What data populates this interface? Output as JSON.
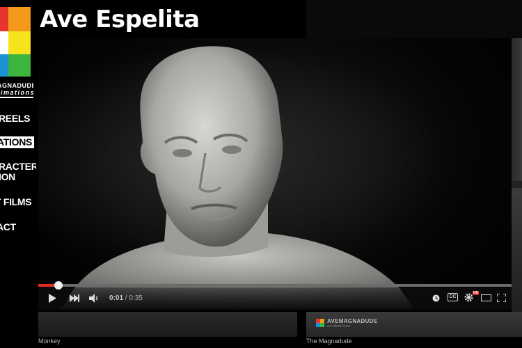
{
  "site": {
    "title": "Ave Espelita",
    "logo_line1": "MAGNADUDE",
    "logo_line2": "Animations",
    "logo_colors": [
      "#e8352b",
      "#f39a1b",
      "#ffffff",
      "#f6e31c",
      "#1a94d2",
      "#3db43d",
      "#f7d50f"
    ]
  },
  "nav": {
    "items": [
      {
        "label": "REELS",
        "active": false
      },
      {
        "label": "ATIONS",
        "active": true
      },
      {
        "label": "RACTER",
        "active": false
      },
      {
        "label": "ION",
        "active": false
      },
      {
        "label": "T FILMS",
        "active": false
      },
      {
        "label": "ACT",
        "active": false
      }
    ]
  },
  "player": {
    "current_time": "0:01",
    "duration": "/ 0:35",
    "progress_fraction": 0.042,
    "play_icon": "play-icon",
    "next_icon": "next-icon",
    "volume_icon": "volume-icon",
    "watch_later_icon": "clock-icon",
    "captions_label": "CC",
    "settings_icon": "gear-icon",
    "hd_label": "HD",
    "theater_icon": "theater-icon",
    "fullscreen_icon": "fullscreen-icon",
    "accent": "#e52d27"
  },
  "thumbnails": [
    {
      "label": "Monkey"
    },
    {
      "label": "The Magnadude",
      "overlay_title": "AVEMAGNADUDE",
      "overlay_sub": "animations"
    }
  ]
}
